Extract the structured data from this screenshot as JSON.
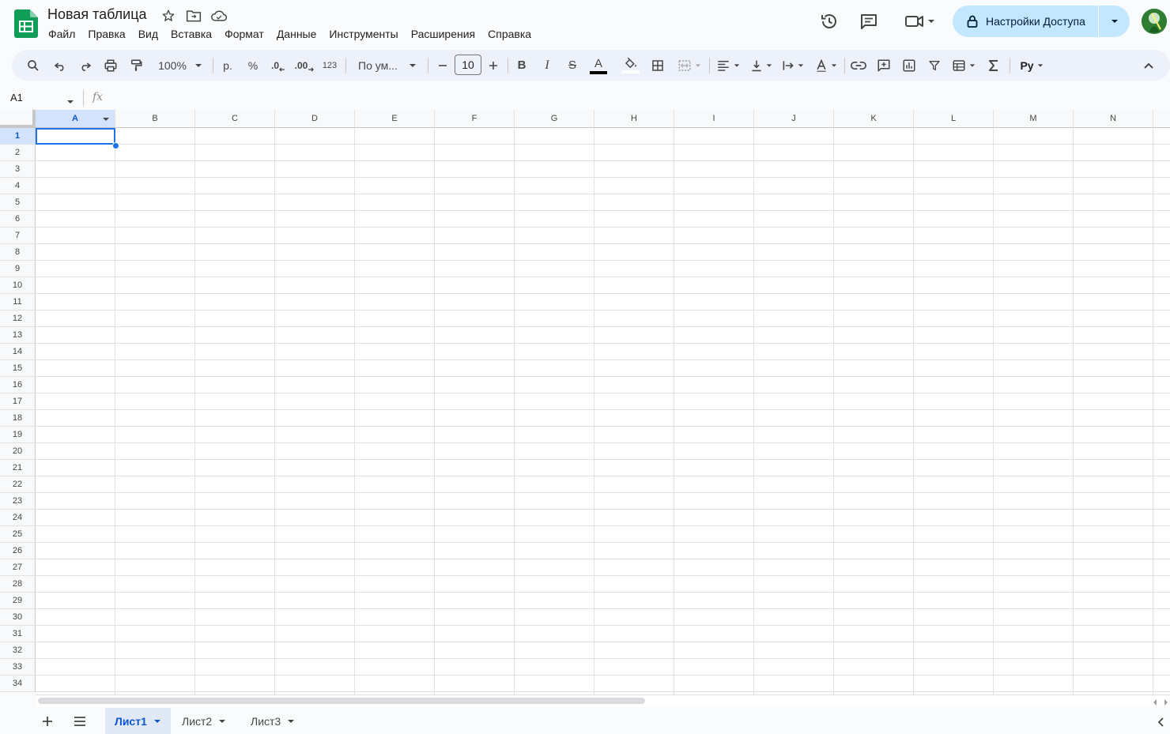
{
  "doc": {
    "title": "Новая таблица"
  },
  "menu": [
    "Файл",
    "Правка",
    "Вид",
    "Вставка",
    "Формат",
    "Данные",
    "Инструменты",
    "Расширения",
    "Справка"
  ],
  "share": {
    "label": "Настройки Доступа"
  },
  "toolbar": {
    "zoom": "100%",
    "currency": "р.",
    "percent": "%",
    "dec_decrease": ".0",
    "dec_increase": ".00",
    "number_format": "123",
    "font": "По ум...",
    "font_size": "10",
    "bold": "B",
    "italic": "I",
    "strike": "S",
    "text_color": "A",
    "input_tools": "Ру"
  },
  "formula_bar": {
    "cell_ref": "A1",
    "fx": "fx"
  },
  "columns": [
    "A",
    "B",
    "C",
    "D",
    "E",
    "F",
    "G",
    "H",
    "I",
    "J",
    "K",
    "L",
    "M",
    "N"
  ],
  "rows": [
    "1",
    "2",
    "3",
    "4",
    "5",
    "6",
    "7",
    "8",
    "9",
    "10",
    "11",
    "12",
    "13",
    "14",
    "15",
    "16",
    "17",
    "18",
    "19",
    "20",
    "21",
    "22",
    "23",
    "24",
    "25",
    "26",
    "27",
    "28",
    "29",
    "30",
    "31",
    "32",
    "33",
    "34"
  ],
  "selected": {
    "column": "A",
    "row": "1"
  },
  "sheets": [
    {
      "name": "Лист1",
      "active": true
    },
    {
      "name": "Лист2",
      "active": false
    },
    {
      "name": "Лист3",
      "active": false
    }
  ],
  "colors": {
    "accent": "#0b57d0",
    "share_bg": "#c2e7ff",
    "toolbar_bg": "#edf2fa",
    "sheets_green": "#0f9d58"
  }
}
